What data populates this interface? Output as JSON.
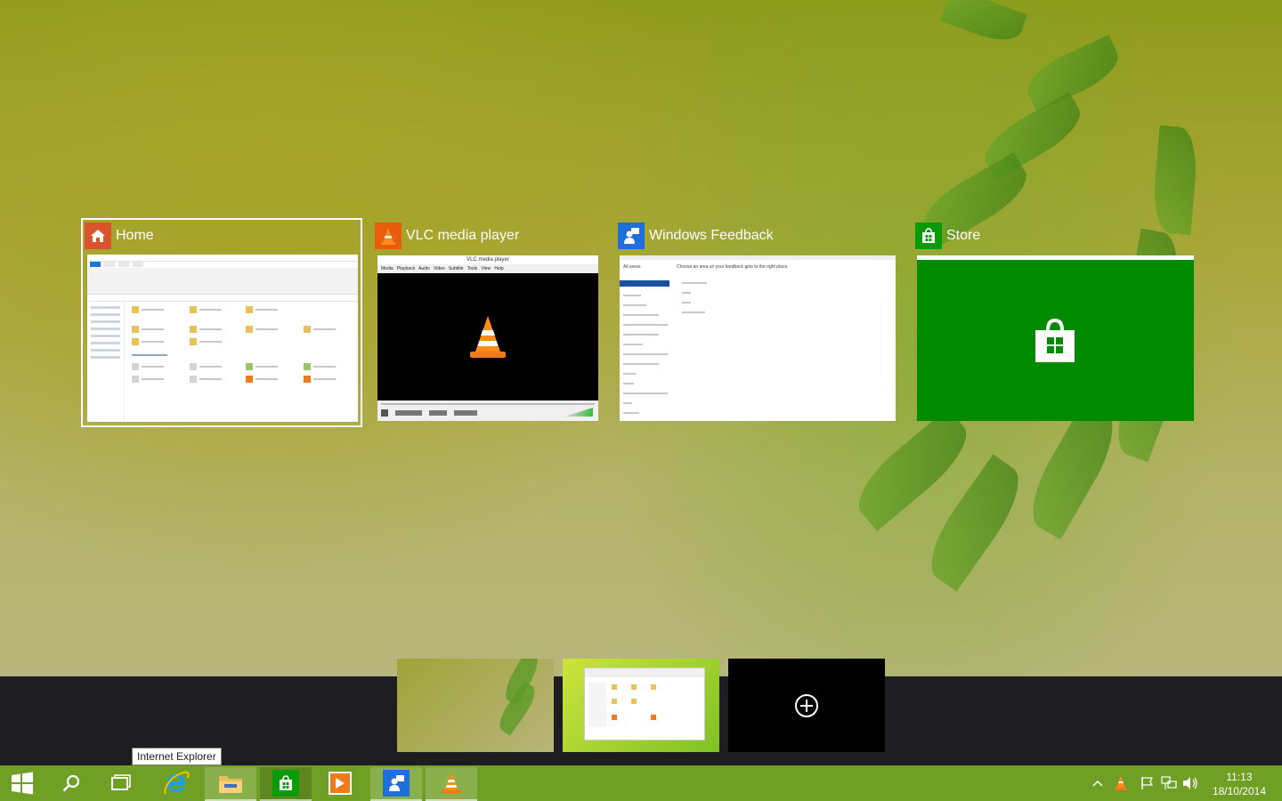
{
  "task_view": {
    "windows": [
      {
        "title": "Home",
        "icon": "home-icon",
        "accent": "#d9532c",
        "selected": true
      },
      {
        "title": "VLC media player",
        "icon": "vlc-cone-icon",
        "accent": "#e85d0c",
        "selected": false
      },
      {
        "title": "Windows Feedback",
        "icon": "feedback-icon",
        "accent": "#1e6fd9",
        "selected": false
      },
      {
        "title": "Store",
        "icon": "store-bag-icon",
        "accent": "#0a9a0a",
        "selected": false
      }
    ],
    "vlc": {
      "window_title": "VLC media player",
      "menu": [
        "Media",
        "Playback",
        "Audio",
        "Video",
        "Subtitle",
        "Tools",
        "View",
        "Help"
      ]
    },
    "feedback": {
      "sidebar_header": "All areas",
      "prompt": "Choose an area so your feedback gets to the right place."
    }
  },
  "desktops": {
    "add_label": "+"
  },
  "tooltip": "Internet Explorer",
  "taskbar": {
    "pinned_apps": [
      "internet-explorer-icon",
      "file-explorer-icon",
      "store-icon",
      "media-player-icon",
      "feedback-icon",
      "vlc-cone-icon"
    ],
    "clock": {
      "time": "11:13",
      "date": "18/10/2014"
    }
  },
  "colors": {
    "taskbar": "#6f9f25",
    "store_tile": "#008a00",
    "vd_band": "#1e1e20"
  }
}
